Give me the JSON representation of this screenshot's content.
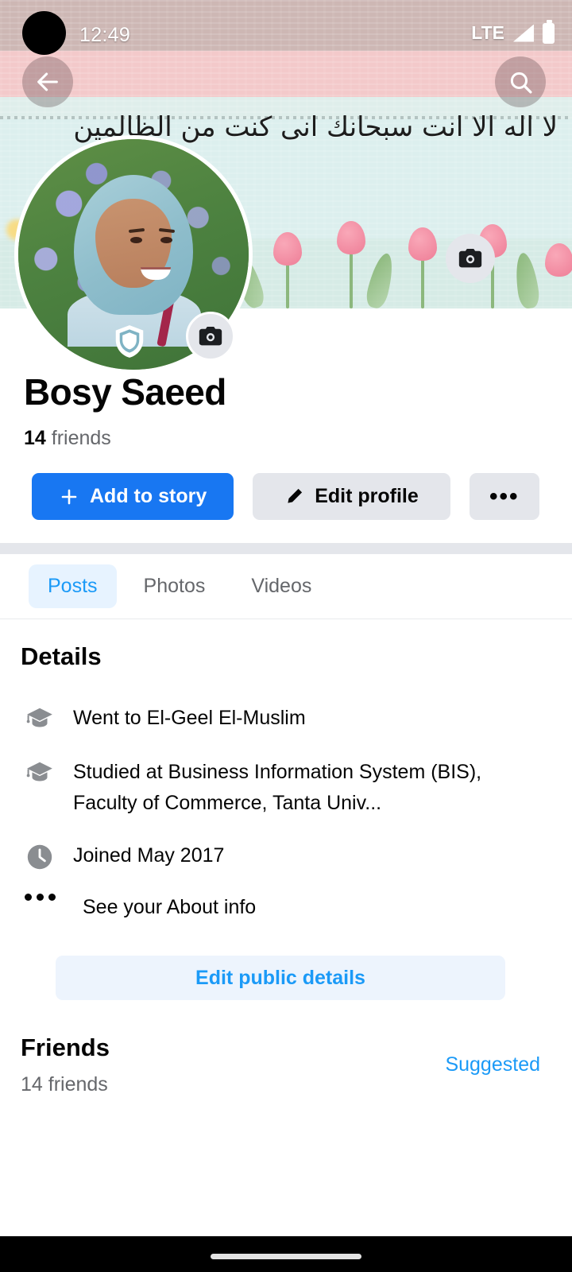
{
  "status_bar": {
    "time": "12:49",
    "network": "LTE",
    "signal_icon": "signal-bars-icon",
    "battery_icon": "battery-full-icon"
  },
  "cover": {
    "back_icon": "back-arrow-icon",
    "search_icon": "search-icon",
    "camera_icon": "camera-icon",
    "calligraphy": "لا اله الا انت سبحانك انى كنت من الظالمين",
    "avatar_camera_icon": "camera-icon",
    "profile_guard_icon": "shield-icon"
  },
  "profile": {
    "name": "Bosy Saeed",
    "friends_number": "14",
    "friends_word": "friends"
  },
  "actions": {
    "add_story_label": "Add to story",
    "add_story_icon": "plus-icon",
    "edit_profile_label": "Edit profile",
    "edit_profile_icon": "pencil-icon",
    "more_label": "•••",
    "more_icon": "ellipsis-icon"
  },
  "tabs": [
    {
      "label": "Posts",
      "active": true
    },
    {
      "label": "Photos",
      "active": false
    },
    {
      "label": "Videos",
      "active": false
    }
  ],
  "details": {
    "heading": "Details",
    "rows": [
      {
        "icon": "graduation-cap-icon",
        "text": "Went to El-Geel El-Muslim"
      },
      {
        "icon": "graduation-cap-icon",
        "text": "Studied at Business Information System (BIS), Faculty of Commerce, Tanta Univ..."
      },
      {
        "icon": "clock-icon",
        "text": "Joined May 2017"
      },
      {
        "icon": "ellipsis-icon",
        "text": "See your About info"
      }
    ],
    "edit_public_label": "Edit public details"
  },
  "friends_section": {
    "heading": "Friends",
    "subtitle": "14 friends",
    "suggested_label": "Suggested"
  },
  "nav_bar": {
    "home_indicator": "home-indicator-pill"
  },
  "colors": {
    "brand_blue": "#1877f2",
    "link_blue": "#1b9af7",
    "tab_pill_bg": "#e7f3ff",
    "button_gray": "#e4e6eb",
    "text_primary": "#050505",
    "text_secondary": "#65676b"
  }
}
